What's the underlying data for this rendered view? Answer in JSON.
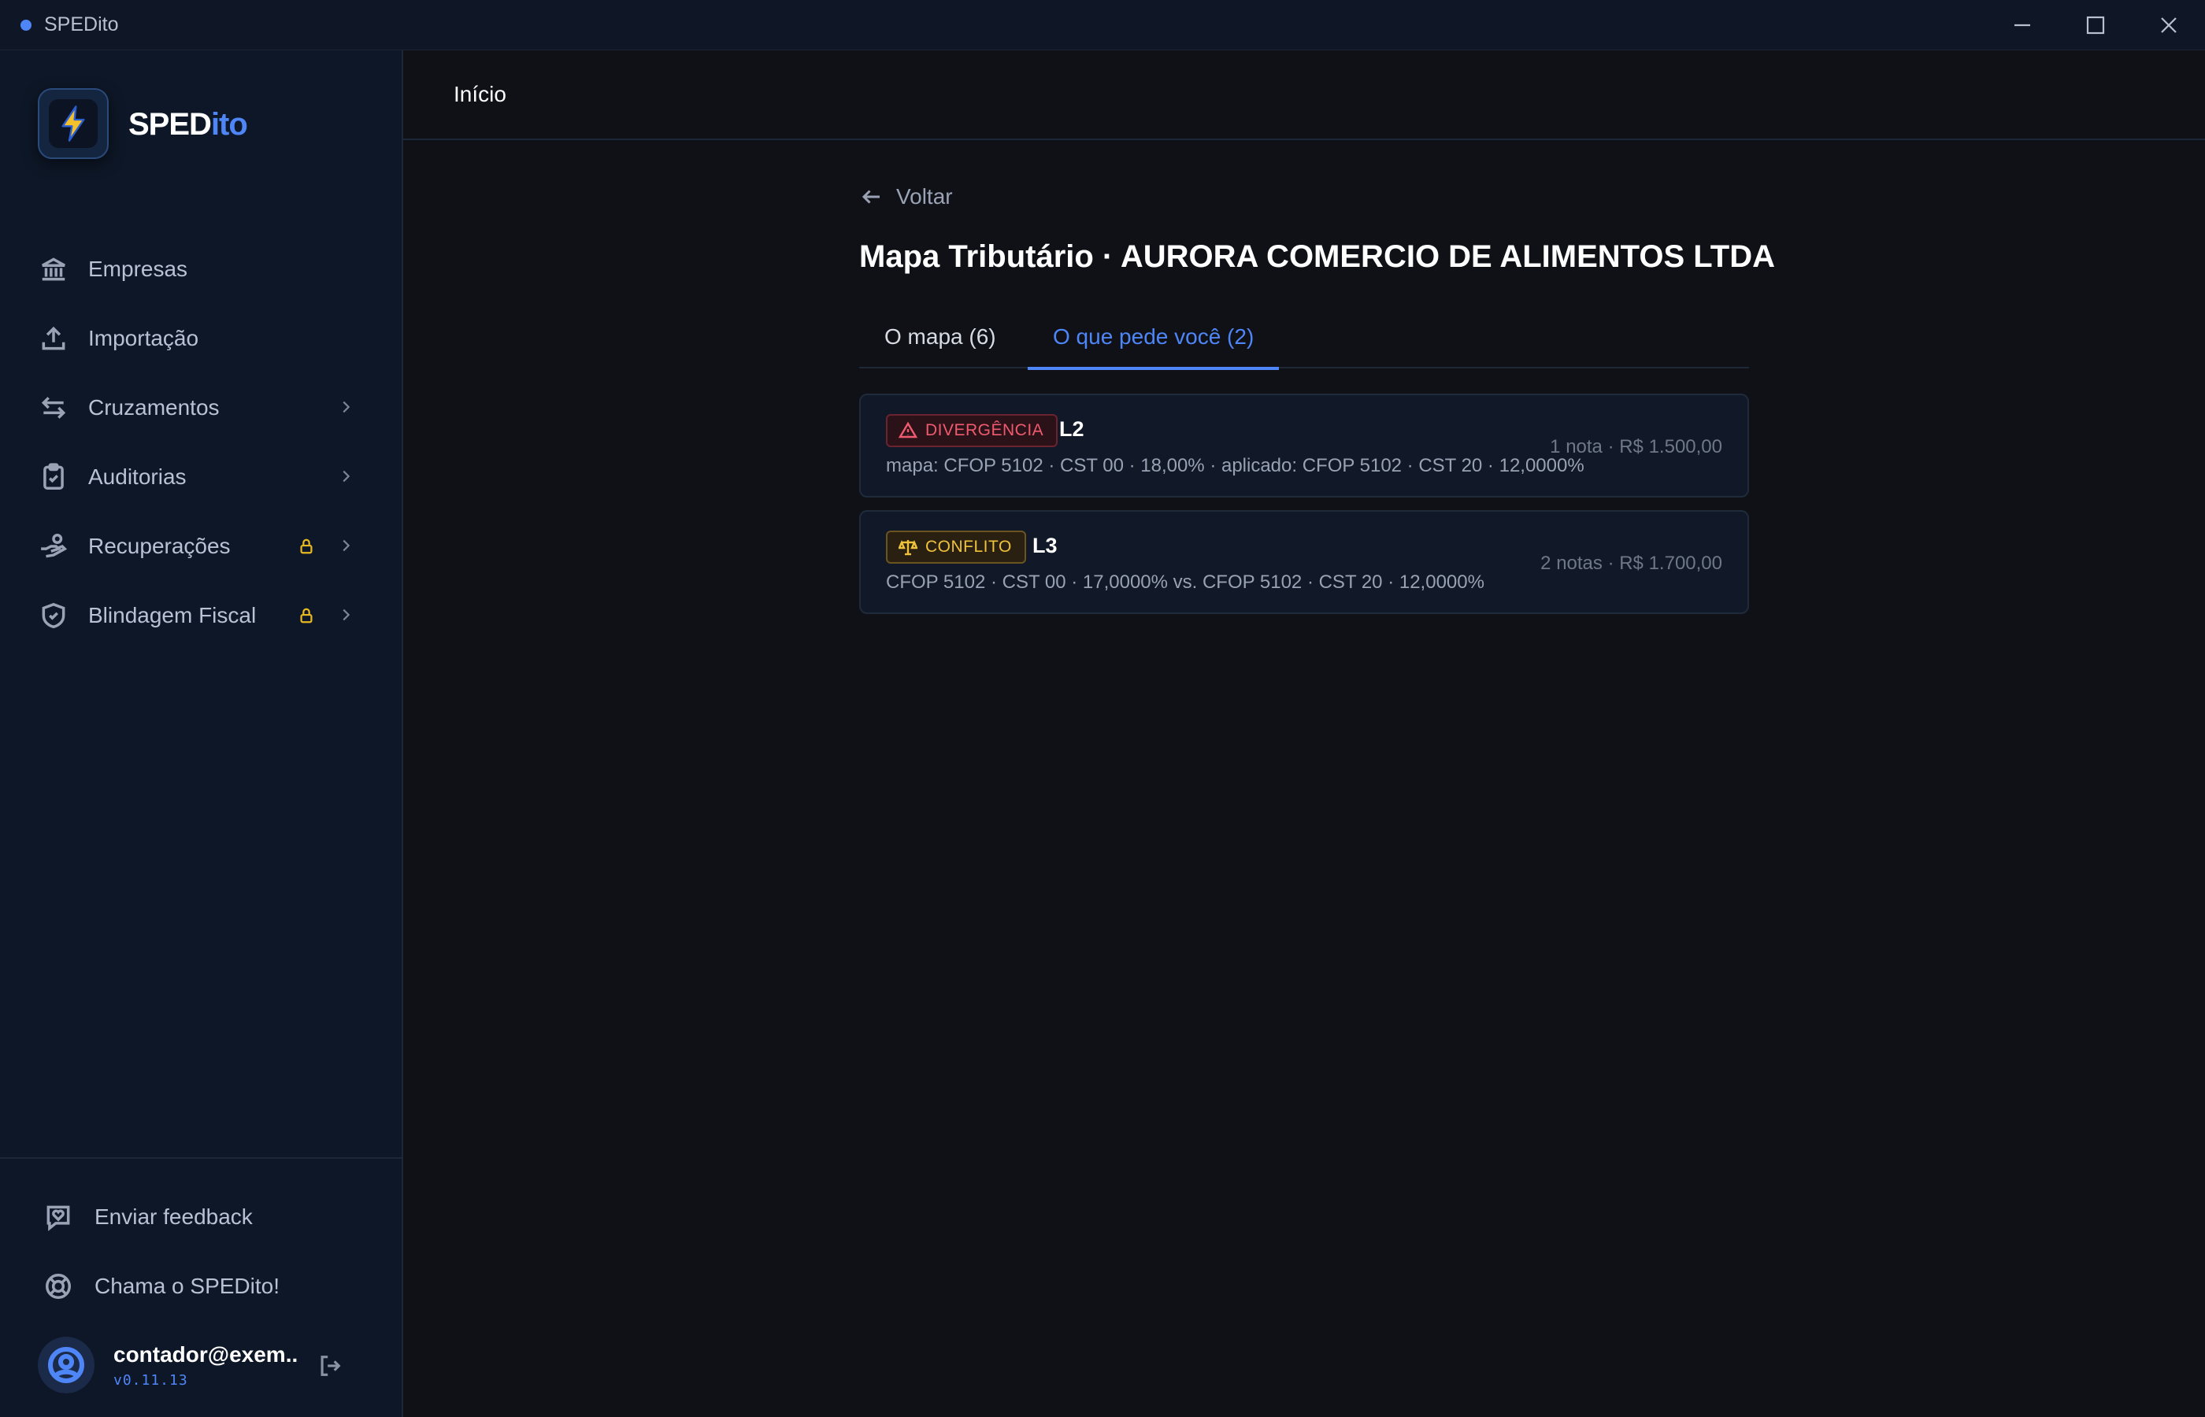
{
  "window": {
    "title": "SPEDito"
  },
  "brand": {
    "part1": "SPED",
    "part2": "ito"
  },
  "sidebar": {
    "items": [
      {
        "label": "Empresas",
        "icon": "bank-icon"
      },
      {
        "label": "Importação",
        "icon": "upload-icon"
      },
      {
        "label": "Cruzamentos",
        "icon": "arrows-exchange-icon"
      },
      {
        "label": "Auditorias",
        "icon": "clipboard-check-icon"
      },
      {
        "label": "Recuperações",
        "icon": "hand-coins-icon",
        "locked": true
      },
      {
        "label": "Blindagem Fiscal",
        "icon": "shield-check-icon",
        "locked": true
      }
    ],
    "footer": [
      {
        "label": "Enviar feedback",
        "icon": "message-heart-icon"
      },
      {
        "label": "Chama o SPEDito!",
        "icon": "lifebuoy-icon"
      }
    ],
    "user": {
      "email": "contador@exem...",
      "version": "v0.11.13"
    }
  },
  "breadcrumb": "Início",
  "main": {
    "back_label": "Voltar",
    "title": "Mapa Tributário · AURORA COMERCIO DE ALIMENTOS LTDA",
    "tabs": [
      {
        "label": "O mapa (6)",
        "active": false
      },
      {
        "label": "O que pede você (2)",
        "active": true
      }
    ],
    "cards": [
      {
        "badge": "DIVERGÊNCIA",
        "badge_color": "#ef5a6f",
        "code": "L2",
        "description": "mapa: CFOP 5102 · CST 00 · 18,00% · aplicado: CFOP 5102 · CST 20 · 12,0000%",
        "meta": "1 nota · R$ 1.500,00"
      },
      {
        "badge": "CONFLITO",
        "badge_color": "#f0c23a",
        "code": "L3",
        "description": "CFOP 5102 · CST 00 · 17,0000% vs. CFOP 5102 · CST 20 · 12,0000%",
        "meta": "2 notas · R$ 1.700,00"
      }
    ]
  },
  "colors": {
    "accent": "#4f86f7",
    "background": "#0f1117",
    "sidebar": "#0e1727",
    "lock": "#e8b923"
  }
}
